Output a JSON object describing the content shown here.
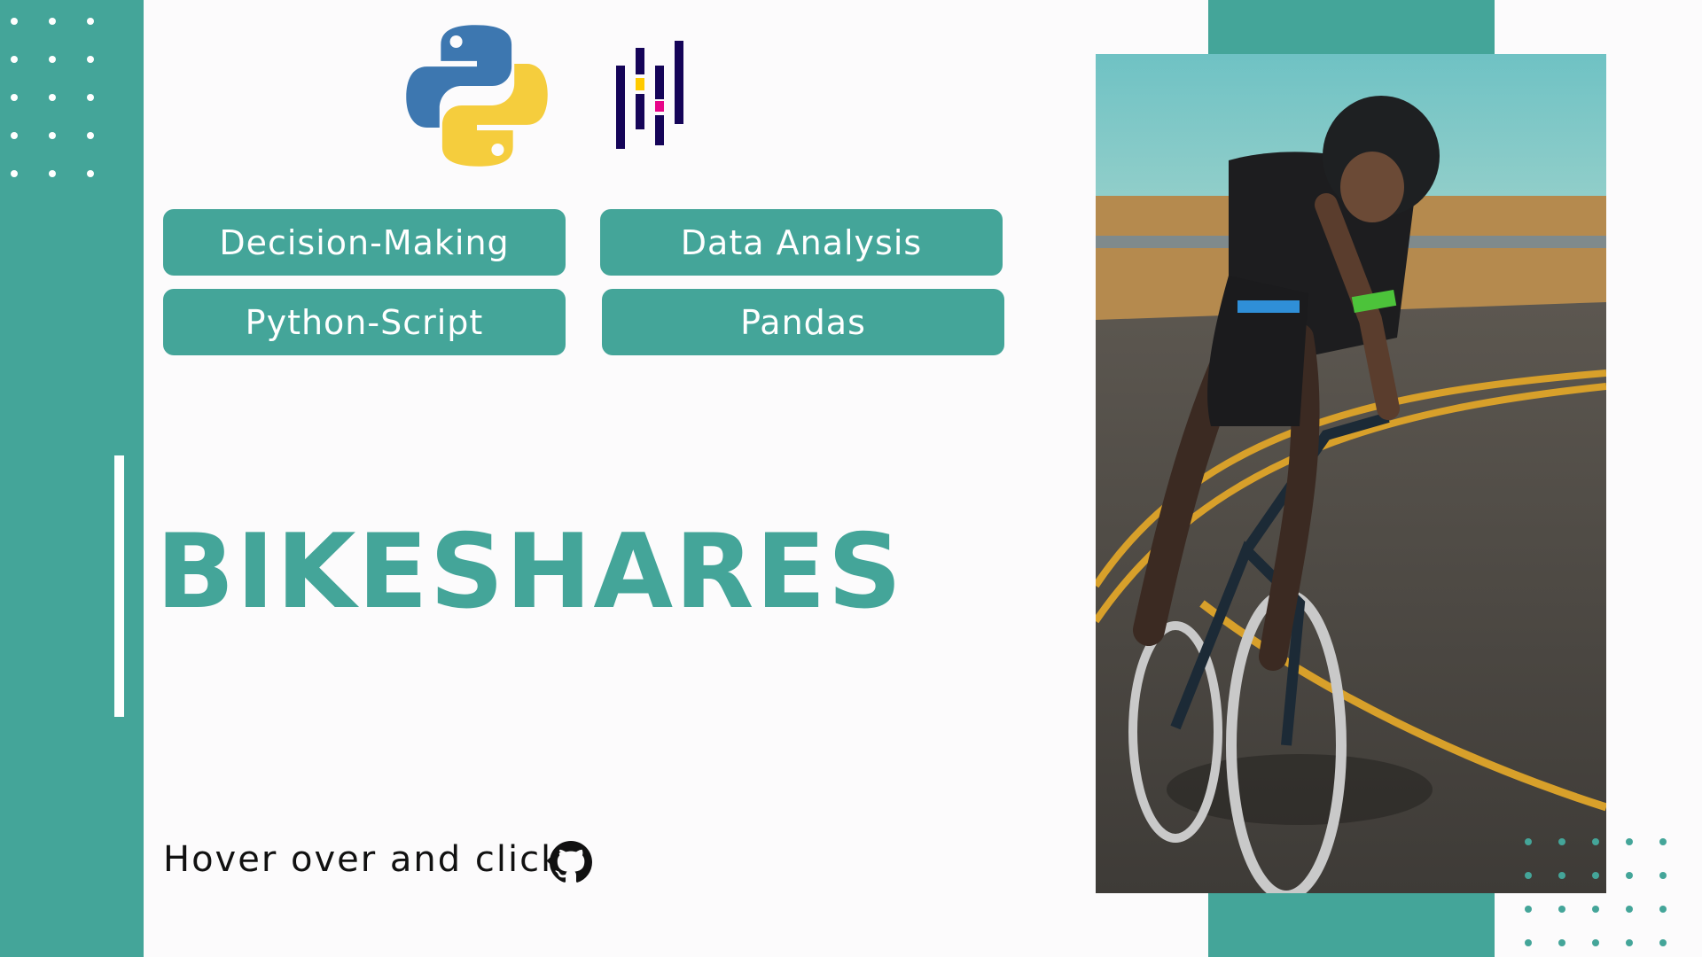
{
  "title": "BIKESHARES",
  "tags": [
    "Decision-Making",
    "Data Analysis",
    "Python-Script",
    "Pandas"
  ],
  "cta": {
    "text": "Hover over and click"
  },
  "icons": {
    "python": "python-logo",
    "pandas": "pandas-logo",
    "github": "github-icon"
  },
  "colors": {
    "accent": "#44a599",
    "background": "#fcfbfc",
    "text": "#111111"
  }
}
